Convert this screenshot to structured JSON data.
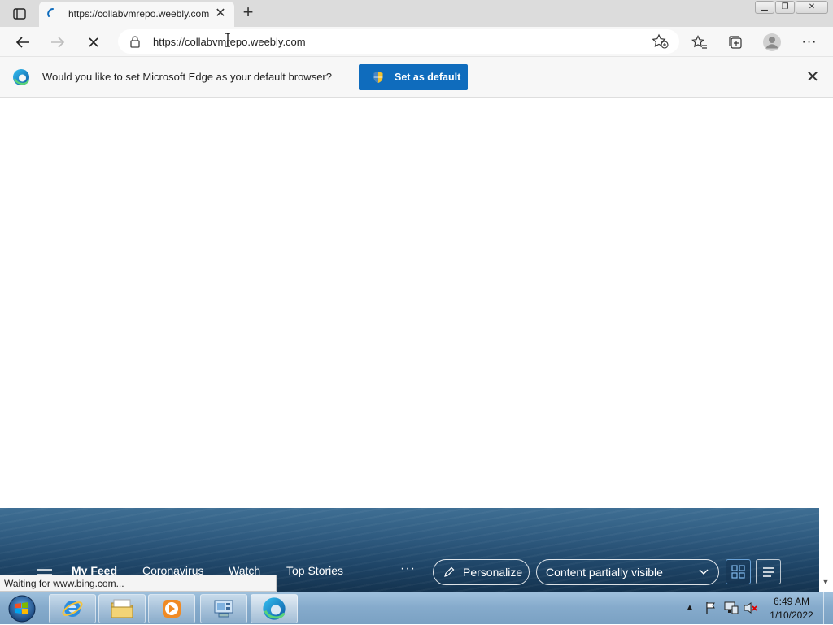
{
  "browser": {
    "tab": {
      "title": "https://collabvmrepo.weebly.com"
    },
    "address": {
      "url": "https://collabvmrepo.weebly.com"
    }
  },
  "infobar": {
    "message": "Would you like to set Microsoft Edge as your default browser?",
    "button_label": "Set as default"
  },
  "feed": {
    "tabs": [
      "My Feed",
      "Coronavirus",
      "Watch",
      "Top Stories"
    ],
    "more": "···",
    "personalize_label": "Personalize",
    "content_visibility": "Content partially visible"
  },
  "status_text": "Waiting for www.bing.com...",
  "taskbar": {
    "time": "6:49 AM",
    "date": "1/10/2022"
  },
  "colors": {
    "accent": "#0f6cbd",
    "feed_background": "#1e4466",
    "taskbar": "#86abcc"
  },
  "icons": [
    "tab-actions-icon",
    "loading-spinner-icon",
    "close-icon",
    "plus-icon",
    "back-icon",
    "forward-icon",
    "stop-icon",
    "lock-icon",
    "add-favorite-icon",
    "favorites-icon",
    "collections-icon",
    "profile-icon",
    "more-icon",
    "edge-icon",
    "shield-icon",
    "hamburger-icon",
    "pencil-icon",
    "chevron-down-icon",
    "grid-icon",
    "list-icon",
    "windows-start-icon",
    "ie-icon",
    "folder-icon",
    "media-player-icon",
    "devices-icon",
    "flag-icon",
    "network-icon",
    "volume-muted-icon"
  ]
}
